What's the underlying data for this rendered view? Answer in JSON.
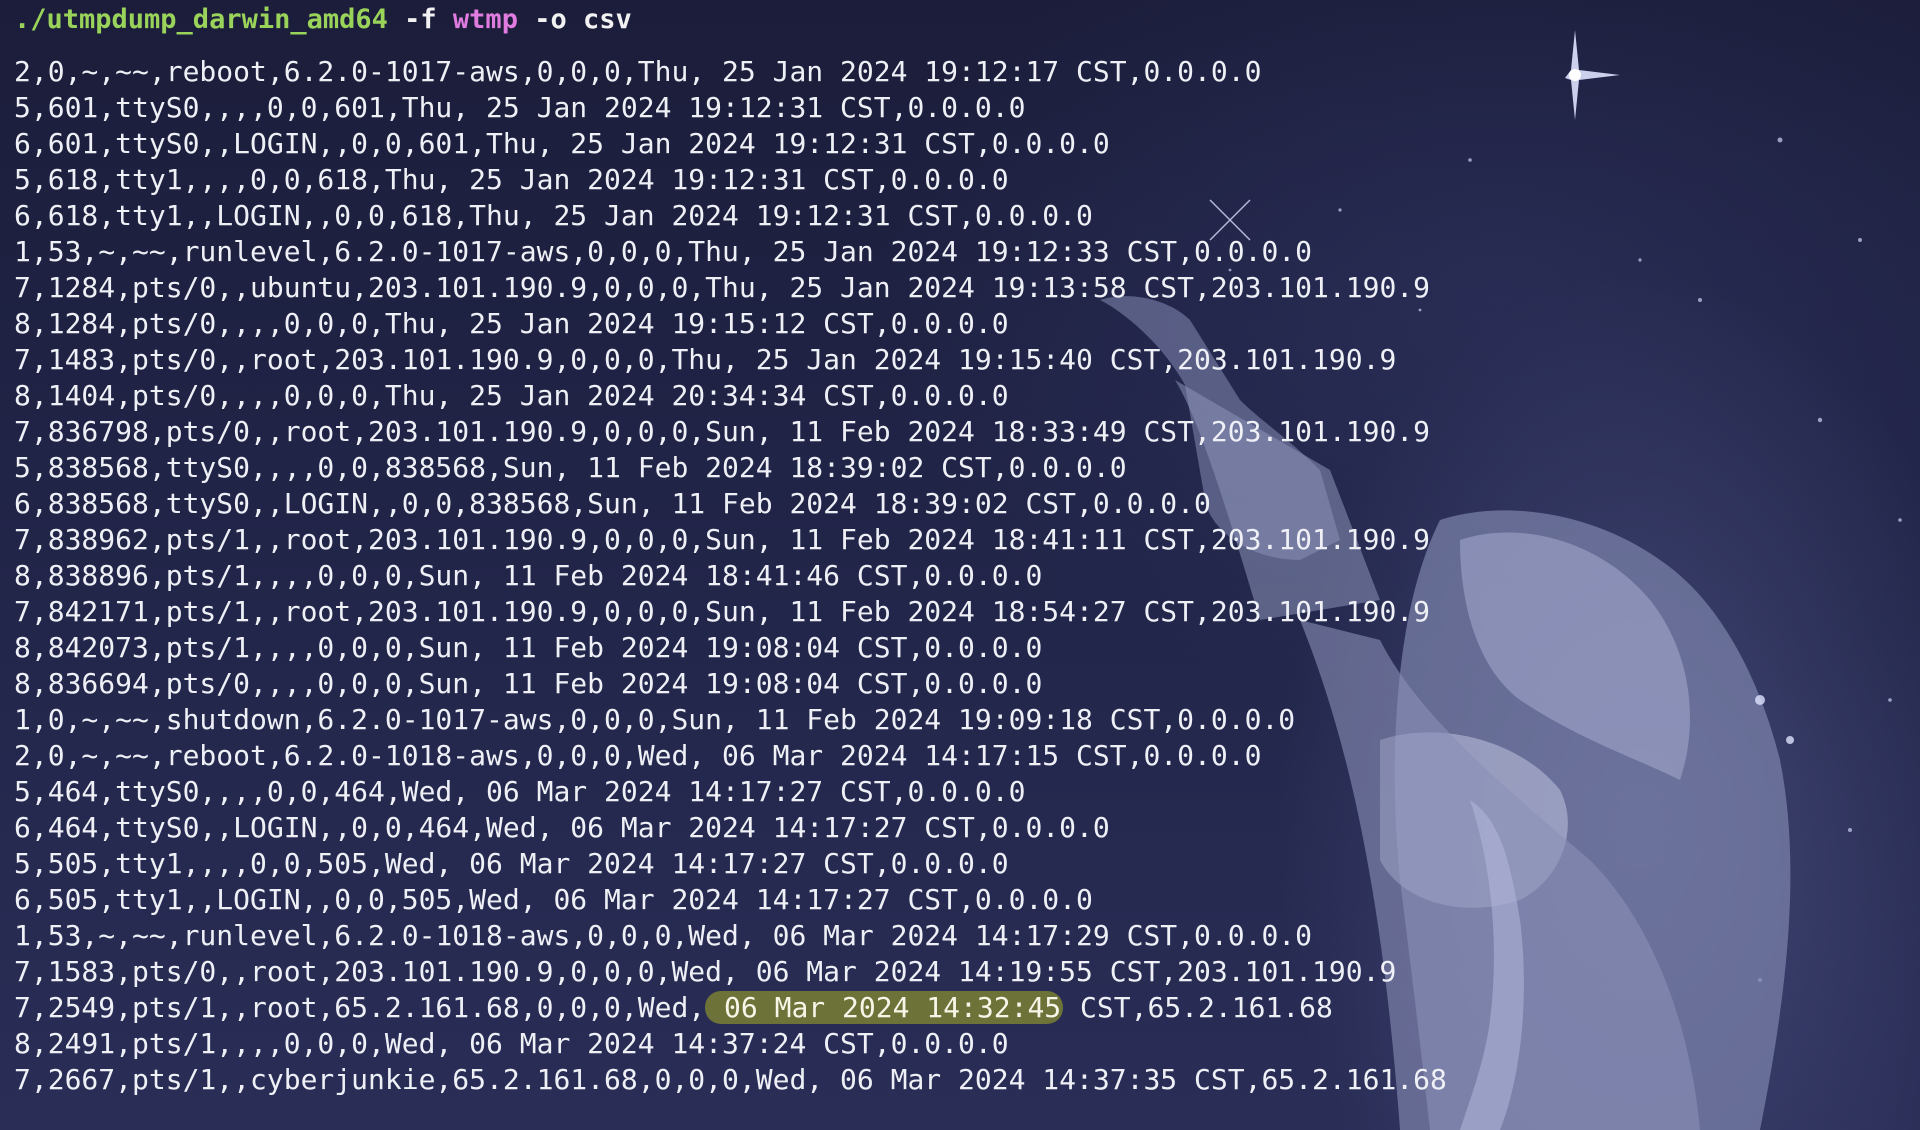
{
  "terminal": {
    "command": {
      "path": "./utmpdump_darwin_amd64",
      "flag_f": "-f",
      "file": "wtmp",
      "flag_o": "-o csv"
    },
    "highlight_color": "#6d7238",
    "lines": [
      {
        "text": "2,0,~,~~,reboot,6.2.0-1017-aws,0,0,0,Thu, 25 Jan 2024 19:12:17 CST,0.0.0.0"
      },
      {
        "text": "5,601,ttyS0,,,,0,0,601,Thu, 25 Jan 2024 19:12:31 CST,0.0.0.0"
      },
      {
        "text": "6,601,ttyS0,,LOGIN,,0,0,601,Thu, 25 Jan 2024 19:12:31 CST,0.0.0.0"
      },
      {
        "text": "5,618,tty1,,,,0,0,618,Thu, 25 Jan 2024 19:12:31 CST,0.0.0.0"
      },
      {
        "text": "6,618,tty1,,LOGIN,,0,0,618,Thu, 25 Jan 2024 19:12:31 CST,0.0.0.0"
      },
      {
        "text": "1,53,~,~~,runlevel,6.2.0-1017-aws,0,0,0,Thu, 25 Jan 2024 19:12:33 CST,0.0.0.0"
      },
      {
        "text": "7,1284,pts/0,,ubuntu,203.101.190.9,0,0,0,Thu, 25 Jan 2024 19:13:58 CST,203.101.190.9"
      },
      {
        "text": "8,1284,pts/0,,,,0,0,0,Thu, 25 Jan 2024 19:15:12 CST,0.0.0.0"
      },
      {
        "text": "7,1483,pts/0,,root,203.101.190.9,0,0,0,Thu, 25 Jan 2024 19:15:40 CST,203.101.190.9"
      },
      {
        "text": "8,1404,pts/0,,,,0,0,0,Thu, 25 Jan 2024 20:34:34 CST,0.0.0.0"
      },
      {
        "text": "7,836798,pts/0,,root,203.101.190.9,0,0,0,Sun, 11 Feb 2024 18:33:49 CST,203.101.190.9"
      },
      {
        "text": "5,838568,ttyS0,,,,0,0,838568,Sun, 11 Feb 2024 18:39:02 CST,0.0.0.0"
      },
      {
        "text": "6,838568,ttyS0,,LOGIN,,0,0,838568,Sun, 11 Feb 2024 18:39:02 CST,0.0.0.0"
      },
      {
        "text": "7,838962,pts/1,,root,203.101.190.9,0,0,0,Sun, 11 Feb 2024 18:41:11 CST,203.101.190.9"
      },
      {
        "text": "8,838896,pts/1,,,,0,0,0,Sun, 11 Feb 2024 18:41:46 CST,0.0.0.0"
      },
      {
        "text": "7,842171,pts/1,,root,203.101.190.9,0,0,0,Sun, 11 Feb 2024 18:54:27 CST,203.101.190.9"
      },
      {
        "text": "8,842073,pts/1,,,,0,0,0,Sun, 11 Feb 2024 19:08:04 CST,0.0.0.0"
      },
      {
        "text": "8,836694,pts/0,,,,0,0,0,Sun, 11 Feb 2024 19:08:04 CST,0.0.0.0"
      },
      {
        "text": "1,0,~,~~,shutdown,6.2.0-1017-aws,0,0,0,Sun, 11 Feb 2024 19:09:18 CST,0.0.0.0"
      },
      {
        "text": "2,0,~,~~,reboot,6.2.0-1018-aws,0,0,0,Wed, 06 Mar 2024 14:17:15 CST,0.0.0.0"
      },
      {
        "text": "5,464,ttyS0,,,,0,0,464,Wed, 06 Mar 2024 14:17:27 CST,0.0.0.0"
      },
      {
        "text": "6,464,ttyS0,,LOGIN,,0,0,464,Wed, 06 Mar 2024 14:17:27 CST,0.0.0.0"
      },
      {
        "text": "5,505,tty1,,,,0,0,505,Wed, 06 Mar 2024 14:17:27 CST,0.0.0.0"
      },
      {
        "text": "6,505,tty1,,LOGIN,,0,0,505,Wed, 06 Mar 2024 14:17:27 CST,0.0.0.0"
      },
      {
        "text": "1,53,~,~~,runlevel,6.2.0-1018-aws,0,0,0,Wed, 06 Mar 2024 14:17:29 CST,0.0.0.0"
      },
      {
        "text": "7,1583,pts/0,,root,203.101.190.9,0,0,0,Wed, 06 Mar 2024 14:19:55 CST,203.101.190.9"
      },
      {
        "text": "7,2549,pts/1,,root,65.2.161.68,0,0,0,Wed,",
        "highlight": " 06 Mar 2024 14:32:45",
        "after": " CST,65.2.161.68"
      },
      {
        "text": "8,2491,pts/1,,,,0,0,0,Wed, 06 Mar 2024 14:37:24 CST,0.0.0.0"
      },
      {
        "text": "7,2667,pts/1,,cyberjunkie,65.2.161.68,0,0,0,Wed, 06 Mar 2024 14:37:35 CST,65.2.161.68"
      }
    ]
  }
}
